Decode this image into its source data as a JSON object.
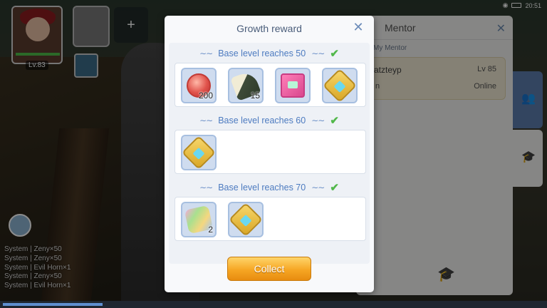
{
  "statusbar": {
    "time": "20:51"
  },
  "party": {
    "leader_level": "Lv.83",
    "add_icon": "add-user-icon"
  },
  "chatlog": [
    "System | Zeny×50",
    "System | Zeny×50",
    "System | Evil Horn×1",
    "System | Zeny×50",
    "System | Evil Horn×1"
  ],
  "mentor_panel": {
    "title": "Mentor",
    "subtitle": "My Mentor",
    "mentor_name": "atzteyp",
    "mentor_level": "Lv 85",
    "mentor_status": "Online",
    "mentor_prefix": "n"
  },
  "modal": {
    "title": "Growth reward",
    "sections": [
      {
        "title": "Base level reaches 50",
        "items": [
          {
            "icon": "tome-icon",
            "amount": "200"
          },
          {
            "icon": "rice-ball-icon",
            "amount": "15"
          },
          {
            "icon": "card-album-icon",
            "amount": ""
          },
          {
            "icon": "gold-box-icon",
            "amount": ""
          }
        ]
      },
      {
        "title": "Base level reaches 60",
        "items": [
          {
            "icon": "gold-box-icon",
            "amount": ""
          }
        ]
      },
      {
        "title": "Base level reaches 70",
        "items": [
          {
            "icon": "rainbow-gem-icon",
            "amount": "2"
          },
          {
            "icon": "gold-box-icon",
            "amount": ""
          }
        ]
      }
    ],
    "collect_label": "Collect"
  },
  "colors": {
    "accent_blue": "#4d7bc0",
    "check_green": "#52b84b",
    "button_orange": "#f6a623"
  }
}
